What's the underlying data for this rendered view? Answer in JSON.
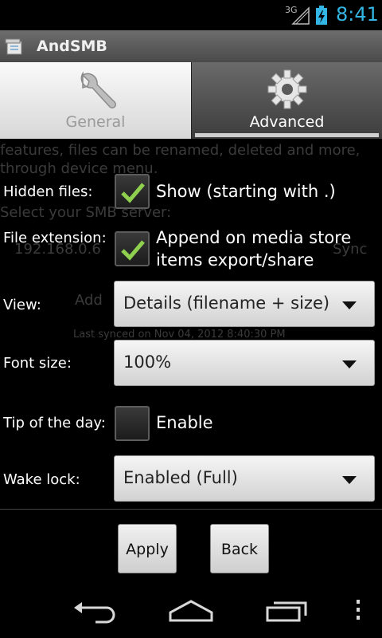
{
  "status_bar": {
    "network": "3G",
    "time": "8:41",
    "accent_color": "#33b5e5"
  },
  "app": {
    "title": "AndSMB",
    "icon": "app-file-icon"
  },
  "tabs": [
    {
      "label": "General",
      "icon": "wrench-icon",
      "selected": false
    },
    {
      "label": "Advanced",
      "icon": "gear-icon",
      "selected": true
    }
  ],
  "background_text": {
    "line1": "features, files can be renamed, deleted and more,",
    "line2": "through device menu.",
    "line3": "Select your SMB server:",
    "server": "192.168.0.6",
    "sync": "Sync",
    "add": "Add",
    "last_synced": "Last synced on Nov 04, 2012 8:40:30 PM"
  },
  "settings": {
    "hidden_files": {
      "label": "Hidden files:",
      "option": "Show (starting with .)",
      "checked": true
    },
    "file_extension": {
      "label": "File extension:",
      "option_line1": "Append on media store",
      "option_line2": "items export/share",
      "checked": true
    },
    "view": {
      "label": "View:",
      "value": "Details (filename + size)"
    },
    "font_size": {
      "label": "Font size:",
      "value": "100%"
    },
    "tip_of_day": {
      "label": "Tip of the day:",
      "option": "Enable",
      "checked": false
    },
    "wake_lock": {
      "label": "Wake lock:",
      "value": "Enabled (Full)"
    }
  },
  "buttons": {
    "apply": "Apply",
    "back": "Back"
  },
  "nav_bar": {
    "back_icon": "back-icon",
    "home_icon": "home-icon",
    "recents_icon": "recents-icon",
    "menu_icon": "overflow-menu-icon"
  }
}
